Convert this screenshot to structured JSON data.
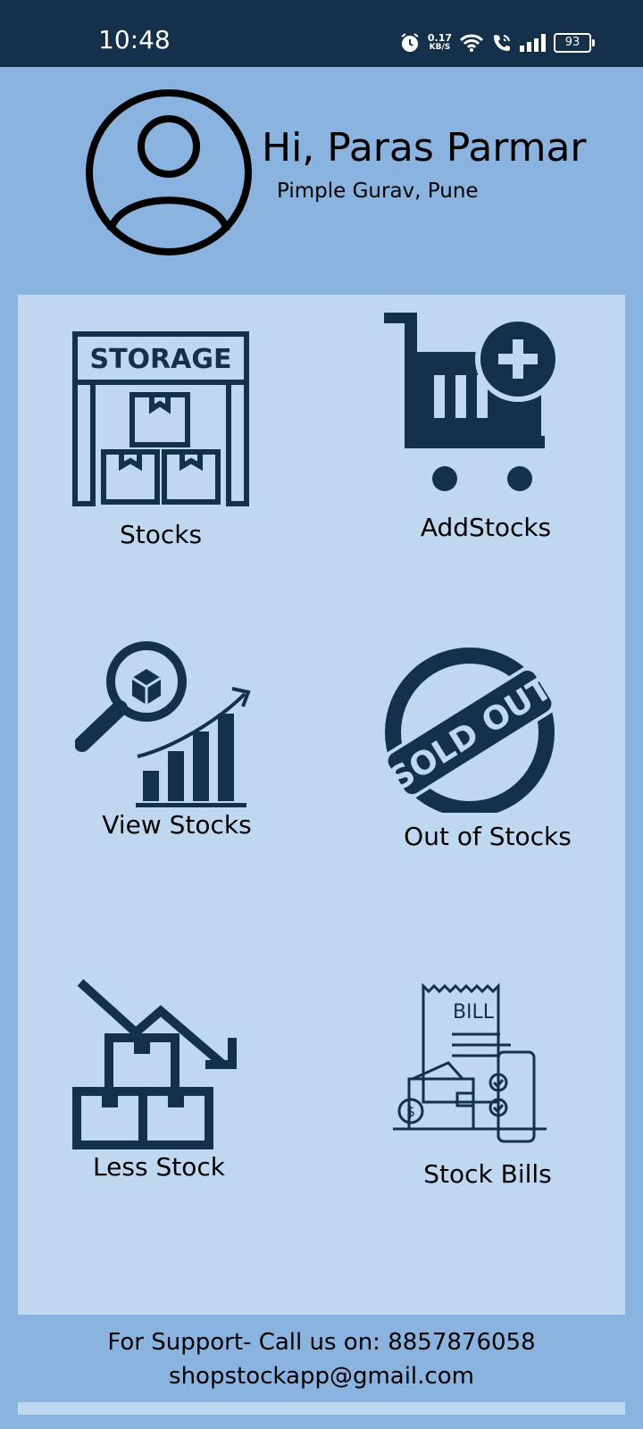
{
  "status_bar": {
    "time": "10:48",
    "network_speed_value": "0.17",
    "network_speed_unit": "KB/S",
    "battery": "93",
    "icons": [
      "alarm-icon",
      "wifi-icon",
      "wifi-call-icon",
      "signal-icon",
      "battery-icon"
    ]
  },
  "profile": {
    "greeting": "Hi, Paras Parmar",
    "location": "Pimple Gurav, Pune",
    "avatar_icon": "user-avatar-icon"
  },
  "menu": {
    "items": [
      {
        "label": "Stocks",
        "icon": "storage-icon"
      },
      {
        "label": "AddStocks",
        "icon": "add-cart-icon"
      },
      {
        "label": "View Stocks",
        "icon": "view-stocks-icon"
      },
      {
        "label": "Out of Stocks",
        "icon": "sold-out-icon"
      },
      {
        "label": "Less Stock",
        "icon": "less-stock-icon"
      },
      {
        "label": "Stock Bills",
        "icon": "bill-icon"
      }
    ],
    "icon_text": {
      "storage": "STORAGE",
      "sold_out": "SOLD OUT",
      "bill": "BILL"
    }
  },
  "support": {
    "line1": "For Support- Call us on: 8857876058",
    "line2": "shopstockapp@gmail.com"
  },
  "colors": {
    "status_bar": "#15304b",
    "background": "#8ab4df",
    "panel": "#c0d8ef",
    "icon": "#15304b"
  }
}
